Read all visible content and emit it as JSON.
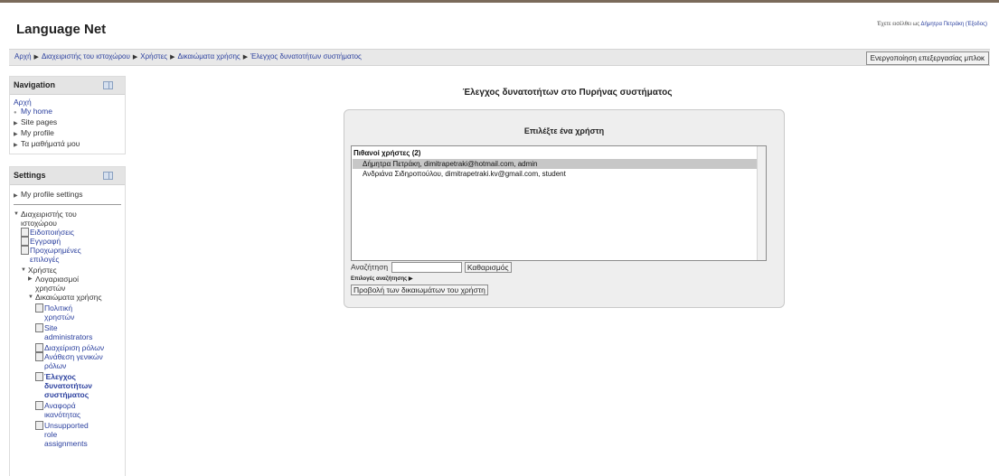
{
  "site": {
    "title": "Language Net",
    "login_prefix": "Έχετε εισέλθει ως",
    "login_user": "Δήμητρα Πετράκη",
    "logout": "(Έξοδος)"
  },
  "breadcrumb": [
    "Αρχή",
    "Διαχειριστής του ιστοχώρου",
    "Χρήστες",
    "Δικαιώματα χρήσης",
    "Έλεγχος δυνατοτήτων συστήματος"
  ],
  "edit_button": "Ενεργοποίηση επεξεργασίας μπλοκ",
  "navigation": {
    "title": "Navigation",
    "home": "Αρχή",
    "items": [
      "My home",
      "Site pages",
      "My profile",
      "Τα μαθήματά μου"
    ]
  },
  "settings": {
    "title": "Settings",
    "profile_settings": "My profile settings",
    "site_admin": "Διαχειριστής του ιστοχώρου",
    "notifications": "Ειδοποιήσεις",
    "registration": "Εγγραφή",
    "advanced": "Προχωρημένες επιλογές",
    "users": "Χρήστες",
    "accounts": "Λογαριασμοί χρηστών",
    "permissions": "Δικαιώματα χρήσης",
    "user_policies": "Πολιτική χρηστών",
    "site_admins": "Site administrators",
    "define_roles": "Διαχείριση ρόλων",
    "assign_global": "Ανάθεση γενικών ρόλων",
    "check_caps": "Έλεγχος δυνατοτήτων συστήματος",
    "cap_report": "Αναφορά ικανότητας",
    "unsupported": "Unsupported role assignments"
  },
  "main": {
    "heading": "Έλεγχος δυνατοτήτων στο Πυρήνας συστήματος",
    "panel_title": "Επιλέξτε ένα χρήστη",
    "group_label": "Πιθανοί χρήστες (2)",
    "users": [
      "Δήμητρα Πετράκη, dimitrapetraki@hotmail.com, admin",
      "Ανδριάνα Σιδηροπούλου, dimitrapetraki.kv@gmail.com, student"
    ],
    "search_label": "Αναζήτηση",
    "search_value": "",
    "clear_button": "Καθαρισμός",
    "search_options": "Επιλογές αναζήτησης ▶",
    "view_button": "Προβολή των δικαιωμάτων του χρήστη"
  },
  "colors": {
    "link": "#2a3f9e",
    "selected_row": "#c7c7c7",
    "panel_bg": "#eeeeee"
  }
}
